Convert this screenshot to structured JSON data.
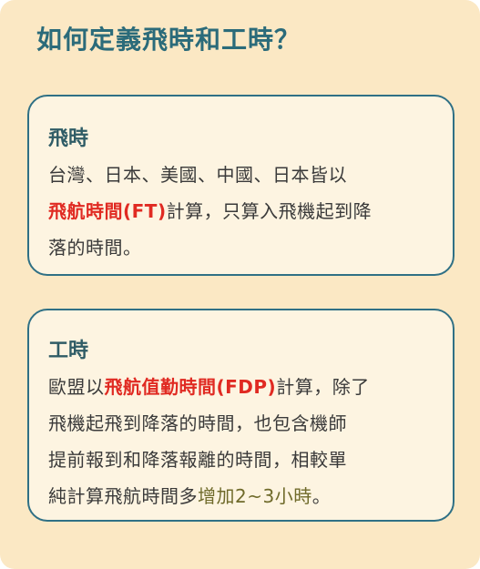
{
  "page": {
    "title": "如何定義飛時和工時？"
  },
  "ft_card": {
    "title": "飛時",
    "line1": "台灣、日本、美國、中國、日本皆以",
    "highlight": "飛航時間(FT)",
    "line2_rest": "計算，只算入飛機起到降",
    "line3": "落的時間。"
  },
  "fdp_card": {
    "title": "工時",
    "prefix": "歐盟以",
    "highlight": "飛航值勤時間(FDP)",
    "after_highlight": "計算，除了",
    "line2": "飛機起飛到降落的時間，也包含機師",
    "line3": "提前報到和降落報離的時間，相較單",
    "line4_prefix": "純計算飛航時間多",
    "green": "增加2~3小時",
    "end": "。"
  },
  "colors": {
    "background": "#fbe8c4",
    "card_background": "#fdf4e1",
    "card_border": "#2f7085",
    "title": "#2b6b7a",
    "highlight_red": "#e02a22",
    "highlight_green": "#6f6a2a"
  }
}
